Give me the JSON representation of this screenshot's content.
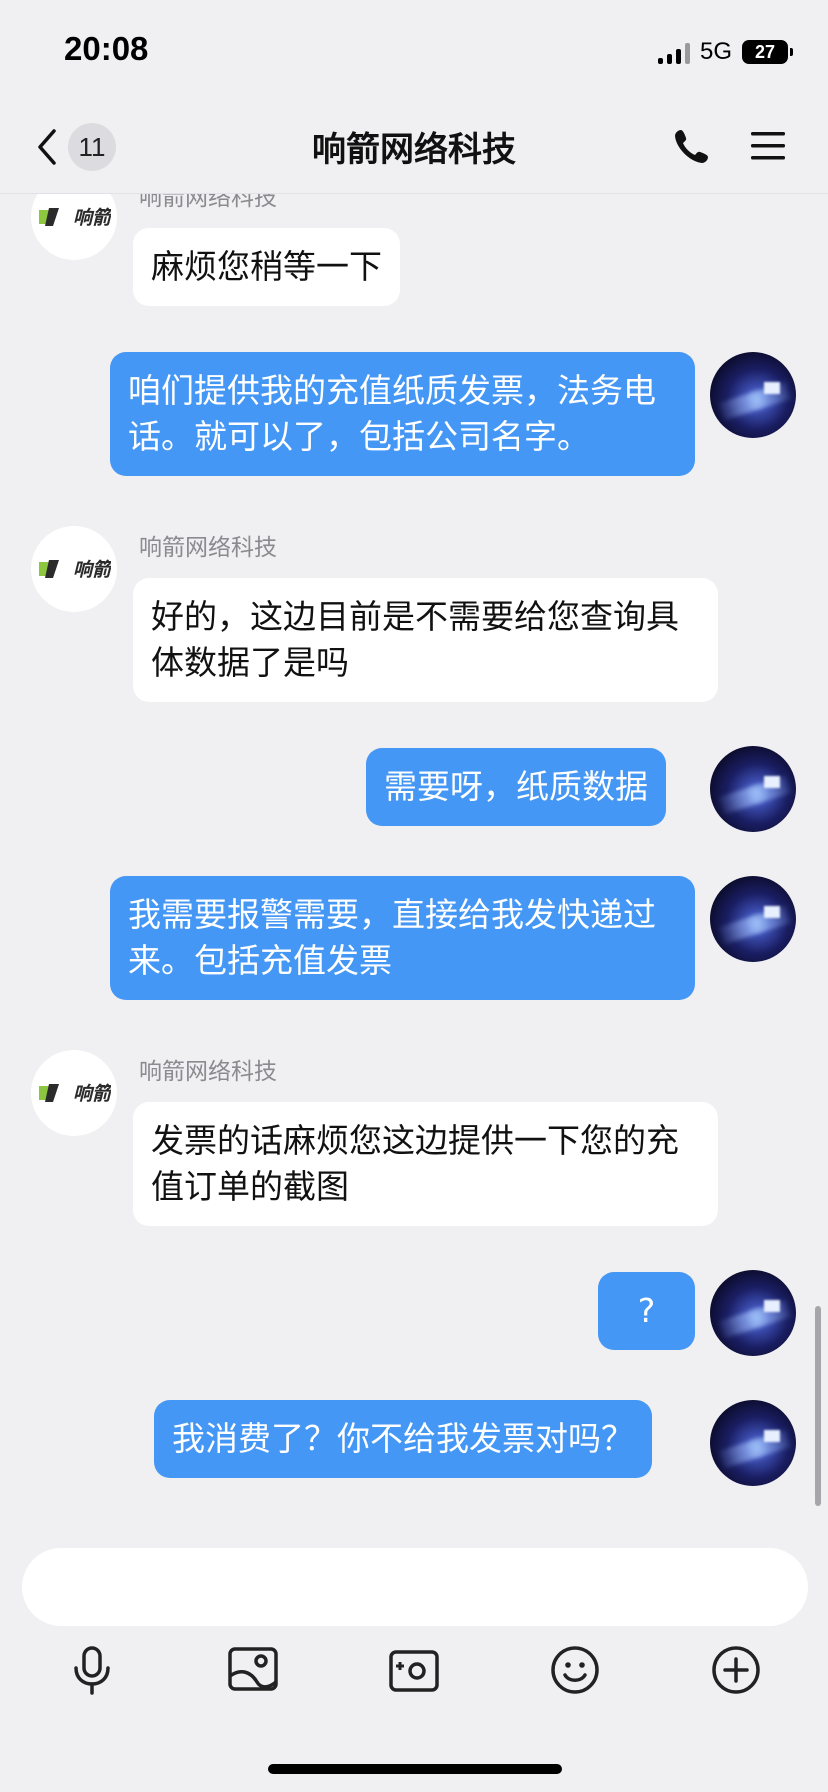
{
  "status_bar": {
    "time": "20:08",
    "network": "5G",
    "battery": "27"
  },
  "header": {
    "back_count": "11",
    "title": "响箭网络科技"
  },
  "brand": {
    "logo_text": "响箭",
    "logo_color": "#8dc63f"
  },
  "messages": [
    {
      "side": "in",
      "sender": "响箭网络科技",
      "text": "麻烦您稍等一下"
    },
    {
      "side": "out",
      "text": "咱们提供我的充值纸质发票，法务电话。就可以了，包括公司名字。"
    },
    {
      "side": "in",
      "sender": "响箭网络科技",
      "text": "好的，这边目前是不需要给您查询具体数据了是吗"
    },
    {
      "side": "out",
      "text": "需要呀，纸质数据"
    },
    {
      "side": "out",
      "text": "我需要报警需要，直接给我发快递过来。包括充值发票"
    },
    {
      "side": "in",
      "sender": "响箭网络科技",
      "text": "发票的话麻烦您这边提供一下您的充值订单的截图"
    },
    {
      "side": "out",
      "text": "?"
    },
    {
      "side": "out",
      "text": "我消费了？你不给我发票对吗？"
    }
  ],
  "toolbar": {
    "icons": [
      "microphone-icon",
      "image-icon",
      "camera-icon",
      "emoji-icon",
      "plus-icon"
    ]
  },
  "colors": {
    "bubble_out": "#4597f5",
    "bubble_in": "#ffffff",
    "background": "#f0f0f2"
  }
}
